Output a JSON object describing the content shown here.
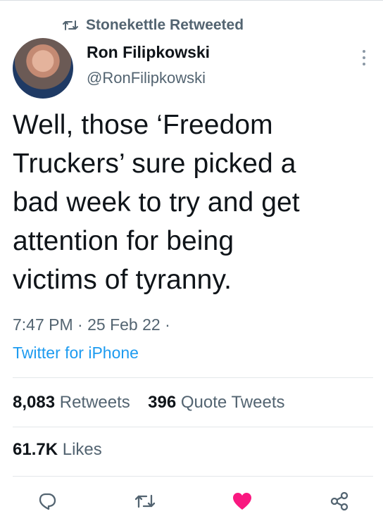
{
  "retweet_context": {
    "text": "Stonekettle Retweeted",
    "icon": "retweet-icon"
  },
  "author": {
    "name": "Ron Filipkowski",
    "handle": "@RonFilipkowski",
    "avatar": "profile-photo"
  },
  "tweet": {
    "lines": [
      "Well, those ‘Freedom",
      "Truckers’ sure picked a",
      "bad week to try and get",
      "attention for being",
      "victims of tyranny."
    ],
    "time": "7:47 PM",
    "date": "25 Feb 22",
    "source": "Twitter for iPhone"
  },
  "stats": {
    "retweets_count": "8,083",
    "retweets_label": "Retweets",
    "quotes_count": "396",
    "quotes_label": "Quote Tweets",
    "likes_count": "61.7K",
    "likes_label": "Likes"
  },
  "actions": {
    "reply_icon": "reply-icon",
    "retweet_icon": "retweet-icon",
    "like_icon": "heart-icon",
    "share_icon": "share-icon"
  },
  "colors": {
    "accent": "#1d9bf0",
    "muted_text": "#536471",
    "primary_text": "#0f1419",
    "like": "#f91880"
  }
}
